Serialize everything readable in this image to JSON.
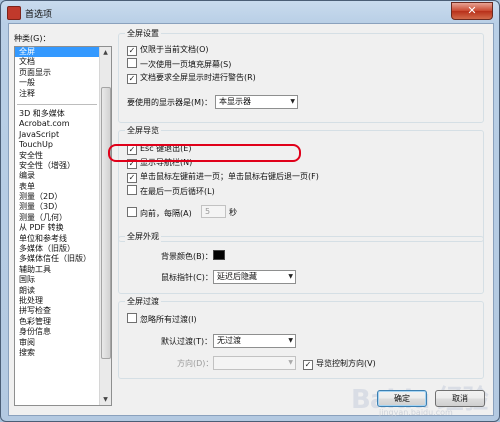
{
  "window": {
    "title": "首选项",
    "close_symbol": "✕"
  },
  "categories": {
    "label": "种类(G)：",
    "top_items": [
      "全屏",
      "文档",
      "页面显示",
      "一般",
      "注释"
    ],
    "items": [
      "3D 和多媒体",
      "Acrobat.com",
      "JavaScript",
      "TouchUp",
      "安全性",
      "安全性（增强）",
      "编录",
      "表单",
      "测量（2D）",
      "测量（3D）",
      "测量（几何）",
      "从 PDF 转换",
      "单位和参考线",
      "多媒体（旧版）",
      "多媒体信任（旧版）",
      "辅助工具",
      "国际",
      "朗读",
      "批处理",
      "拼写检查",
      "色彩管理",
      "身份信息",
      "审阅",
      "搜索"
    ],
    "selected": "全屏"
  },
  "fullscreen_settings": {
    "title": "全屏设置",
    "current_doc_only": "仅限于当前文档(O)",
    "fill_one_page": "一次使用一页填充屏幕(S)",
    "alert_fullscreen": "文档要求全屏显示时进行警告(R)",
    "monitor_label": "要使用的显示器是(M)：",
    "monitor_value": "本显示器"
  },
  "fullscreen_nav": {
    "title": "全屏导览",
    "esc_exit": "Esc 键退出(E)",
    "show_navbar": "显示导航栏(N)",
    "click_nav": "单击鼠标左键前进一页；单击鼠标右键后退一页(F)",
    "loop_last": "在最后一页后循环(L)",
    "advance_every": "向前，每隔(A)",
    "advance_seconds": "5",
    "seconds_unit": "秒"
  },
  "fullscreen_appearance": {
    "title": "全屏外观",
    "bg_color_label": "背景颜色(B)：",
    "bg_color": "#000000",
    "pointer_label": "鼠标指针(C)：",
    "pointer_value": "延迟后隐藏"
  },
  "fullscreen_transition": {
    "title": "全屏过渡",
    "ignore_all": "忽略所有过渡(I)",
    "default_label": "默认过渡(T)：",
    "default_value": "无过渡",
    "direction_label": "方向(D)：",
    "nav_direction": "导览控制方向(V)"
  },
  "buttons": {
    "ok": "确定",
    "cancel": "取消"
  },
  "watermark": {
    "text": "Baidu 经验",
    "url": "jingyan.baidu.com"
  },
  "checkmark": "✓"
}
